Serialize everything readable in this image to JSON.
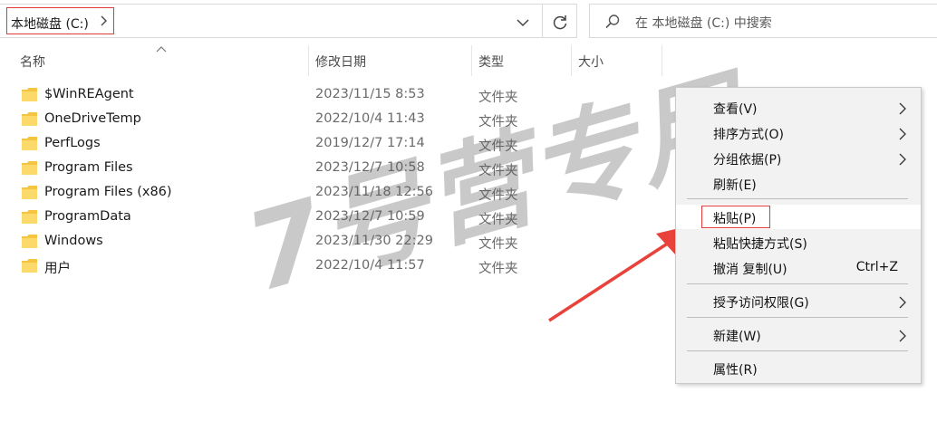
{
  "address": {
    "breadcrumb": "本地磁盘 (C:)"
  },
  "search": {
    "placeholder": "在 本地磁盘 (C:) 中搜索"
  },
  "columns": {
    "name": "名称",
    "modified": "修改日期",
    "type": "类型",
    "size": "大小"
  },
  "files": [
    {
      "name": "$WinREAgent",
      "modified": "2023/11/15 8:53",
      "type": "文件夹"
    },
    {
      "name": "OneDriveTemp",
      "modified": "2022/10/4 11:43",
      "type": "文件夹"
    },
    {
      "name": "PerfLogs",
      "modified": "2019/12/7 17:14",
      "type": "文件夹"
    },
    {
      "name": "Program Files",
      "modified": "2023/12/7 10:58",
      "type": "文件夹"
    },
    {
      "name": "Program Files (x86)",
      "modified": "2023/11/18 12:56",
      "type": "文件夹"
    },
    {
      "name": "ProgramData",
      "modified": "2023/12/7 10:59",
      "type": "文件夹"
    },
    {
      "name": "Windows",
      "modified": "2023/11/30 22:29",
      "type": "文件夹"
    },
    {
      "name": "用户",
      "modified": "2022/10/4 11:57",
      "type": "文件夹"
    }
  ],
  "context_menu": {
    "view": "查看(V)",
    "sort_by": "排序方式(O)",
    "group_by": "分组依据(P)",
    "refresh": "刷新(E)",
    "paste": "粘贴(P)",
    "paste_shortcut": "粘贴快捷方式(S)",
    "undo_copy": "撤消 复制(U)",
    "undo_shortcut": "Ctrl+Z",
    "give_access": "授予访问权限(G)",
    "new": "新建(W)",
    "properties": "属性(R)"
  },
  "watermark": "7号营专用",
  "colors": {
    "highlight_red": "#e23b3b",
    "folder_yellow": "#f5c542",
    "menu_bg": "#f2f2f2"
  },
  "icons": [
    "chevron-right-icon",
    "chevron-down-icon",
    "refresh-icon",
    "search-icon",
    "folder-icon",
    "sort-up-icon",
    "submenu-arrow-icon",
    "red-arrow-icon"
  ]
}
